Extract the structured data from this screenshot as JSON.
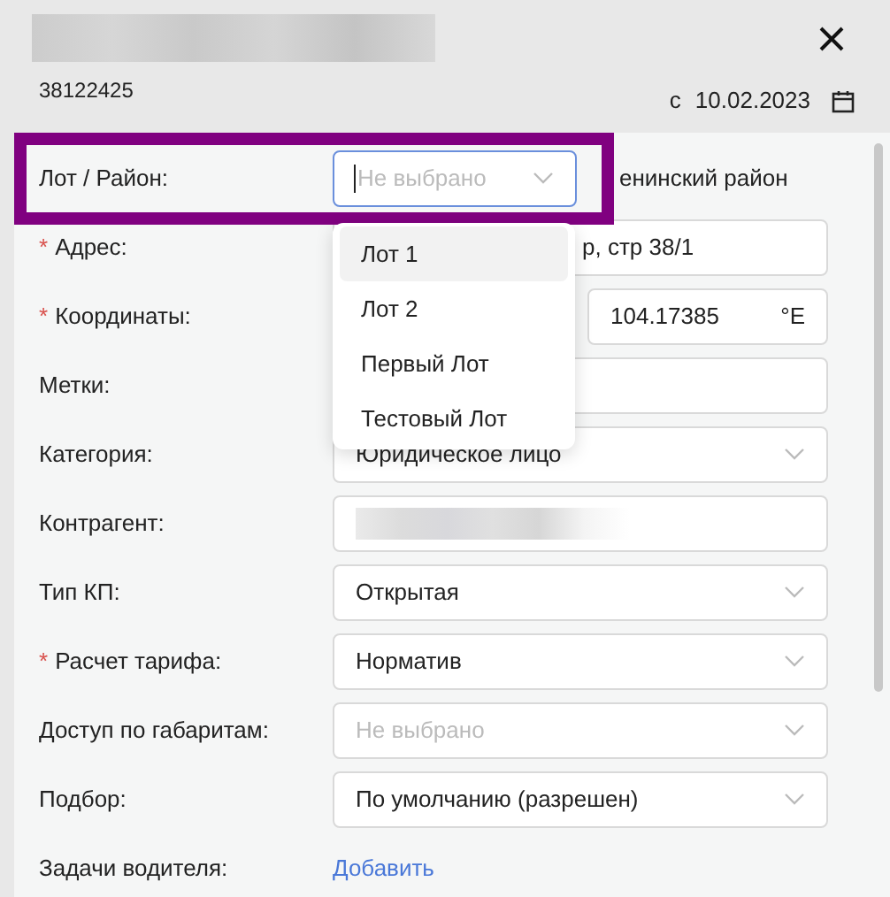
{
  "header": {
    "number": "38122425",
    "date_prefix": "с",
    "date": "10.02.2023"
  },
  "lot": {
    "label": "Лот / Район:",
    "placeholder": "Не выбрано",
    "district": "енинский район",
    "highlighted": true
  },
  "dropdown": [
    {
      "label": "Лот 1",
      "selected": true
    },
    {
      "label": "Лот 2",
      "selected": false
    },
    {
      "label": "Первый Лот",
      "selected": false
    },
    {
      "label": "Тестовый Лот",
      "selected": false
    }
  ],
  "fields": [
    {
      "kind": "text",
      "label": "Адрес:",
      "required_mark": "*",
      "value": "р, стр 38/1"
    },
    {
      "kind": "coords",
      "label": "Координаты:",
      "required_mark": "*",
      "value": "104.17385",
      "unit": "°E"
    },
    {
      "kind": "text",
      "label": "Метки:"
    },
    {
      "kind": "select",
      "label": "Категория:",
      "value": "Юридическое лицо"
    },
    {
      "kind": "blurred",
      "label": "Контрагент:"
    },
    {
      "kind": "select",
      "label": "Тип КП:",
      "value": "Открытая"
    },
    {
      "kind": "select",
      "label": "Расчет тарифа:",
      "required_mark": "*",
      "value": "Норматив"
    },
    {
      "kind": "select",
      "label": "Доступ по габаритам:",
      "placeholder": "Не выбрано"
    },
    {
      "kind": "select",
      "label": "Подбор:",
      "value": "По умолчанию (разрешен)"
    },
    {
      "kind": "link",
      "label": "Задачи водителя:",
      "value": "Добавить"
    }
  ]
}
